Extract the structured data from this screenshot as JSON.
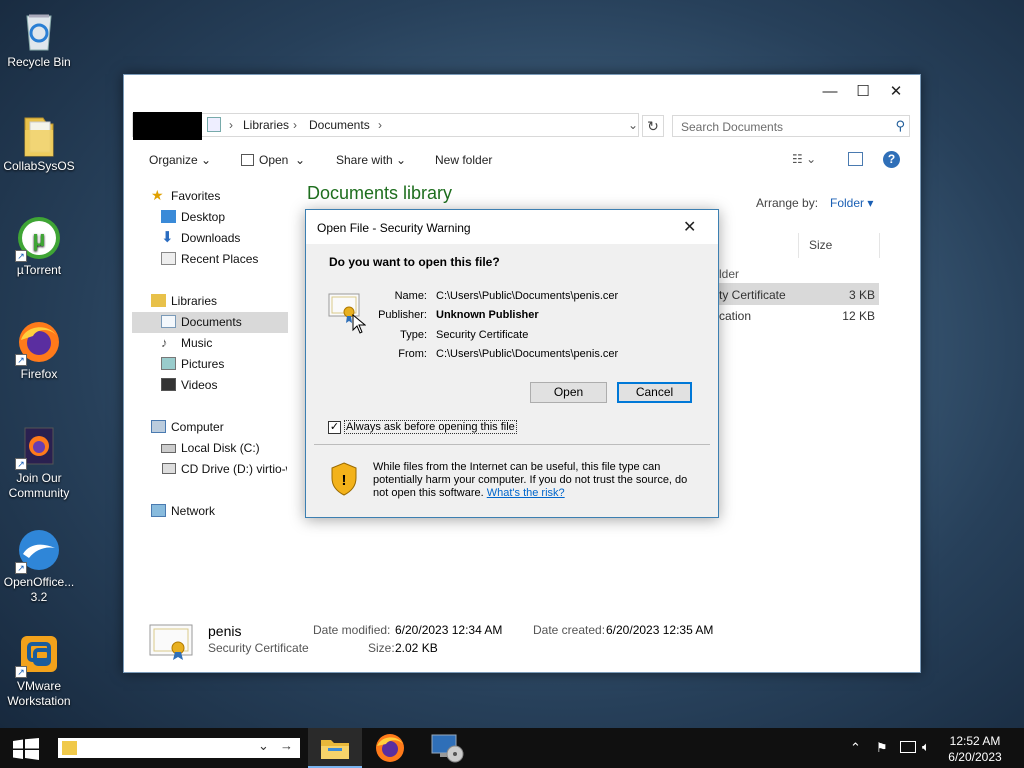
{
  "desktop": {
    "icons": [
      {
        "label": "Recycle Bin"
      },
      {
        "label": "CollabSysOS"
      },
      {
        "label": "µTorrent"
      },
      {
        "label": "Firefox"
      },
      {
        "label": "Join Our Community"
      },
      {
        "label": "OpenOffice... 3.2"
      },
      {
        "label": "VMware Workstation"
      }
    ]
  },
  "explorer": {
    "address": {
      "crumbs": [
        "Libraries",
        "Documents"
      ]
    },
    "search_placeholder": "Search Documents",
    "toolbar": {
      "organize": "Organize",
      "open": "Open",
      "share_with": "Share with",
      "new_folder": "New folder"
    },
    "library_title": "Documents library",
    "arrange_by_label": "Arrange by:",
    "arrange_by_value": "Folder",
    "column_size": "Size",
    "rows": [
      {
        "name_partial": "lder",
        "size": ""
      },
      {
        "name_partial": "ty Certificate",
        "size": "3 KB"
      },
      {
        "name_partial": "cation",
        "size": "12 KB"
      }
    ],
    "nav": {
      "favorites": "Favorites",
      "desktop": "Desktop",
      "downloads": "Downloads",
      "recent": "Recent Places",
      "libraries": "Libraries",
      "documents": "Documents",
      "music": "Music",
      "pictures": "Pictures",
      "videos": "Videos",
      "computer": "Computer",
      "local_disk": "Local Disk (C:)",
      "cd_drive": "CD Drive (D:) virtio-w",
      "network": "Network"
    },
    "details": {
      "name": "penis",
      "type": "Security Certificate",
      "date_modified_label": "Date modified:",
      "date_modified": "6/20/2023 12:34 AM",
      "date_created_label": "Date created:",
      "date_created": "6/20/2023 12:35 AM",
      "size_label": "Size:",
      "size": "2.02 KB"
    }
  },
  "dialog": {
    "title": "Open File - Security Warning",
    "question": "Do you want to open this file?",
    "name_label": "Name:",
    "name": "C:\\Users\\Public\\Documents\\penis.cer",
    "publisher_label": "Publisher:",
    "publisher": "Unknown Publisher",
    "type_label": "Type:",
    "type": "Security Certificate",
    "from_label": "From:",
    "from": "C:\\Users\\Public\\Documents\\penis.cer",
    "open_button": "Open",
    "cancel_button": "Cancel",
    "always_ask": "Always ask before opening this file",
    "always_ask_checked": true,
    "warning_text": "While files from the Internet can be useful, this file type can potentially harm your computer. If you do not trust the source, do not open this software.",
    "risk_link": "What's the risk?"
  },
  "taskbar": {
    "time": "12:52 AM",
    "date": "6/20/2023"
  }
}
